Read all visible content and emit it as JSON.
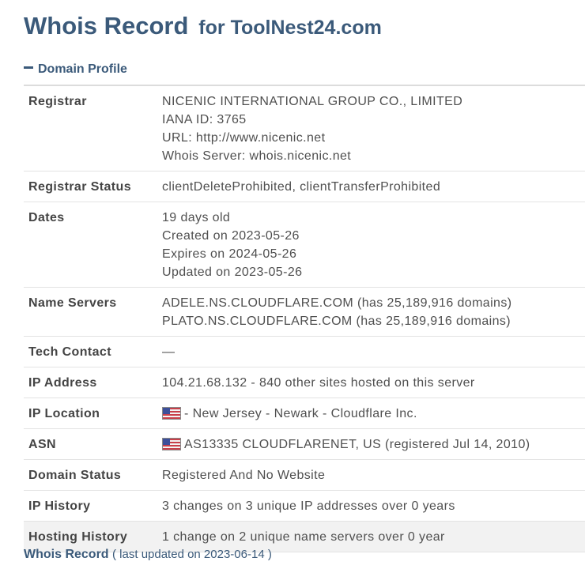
{
  "header": {
    "title": "Whois Record",
    "for_text": "for ToolNest24.com"
  },
  "section": {
    "label": "Domain Profile"
  },
  "rows": {
    "registrar": {
      "label": "Registrar",
      "lines": [
        "NICENIC INTERNATIONAL GROUP CO., LIMITED",
        "IANA ID: 3765",
        "URL: http://www.nicenic.net",
        "Whois Server: whois.nicenic.net"
      ]
    },
    "registrar_status": {
      "label": "Registrar Status",
      "value": "clientDeleteProhibited, clientTransferProhibited"
    },
    "dates": {
      "label": "Dates",
      "lines": [
        "19 days old",
        "Created on 2023-05-26",
        "Expires on 2024-05-26",
        "Updated on 2023-05-26"
      ]
    },
    "name_servers": {
      "label": "Name Servers",
      "lines": [
        "ADELE.NS.CLOUDFLARE.COM (has 25,189,916 domains)",
        "PLATO.NS.CLOUDFLARE.COM (has 25,189,916 domains)"
      ]
    },
    "tech_contact": {
      "label": "Tech Contact",
      "value": "—"
    },
    "ip_address": {
      "label": "IP Address",
      "value": "104.21.68.132 - 840 other sites hosted on this server"
    },
    "ip_location": {
      "label": "IP Location",
      "icon": "us-flag-icon",
      "value": "- New Jersey - Newark - Cloudflare Inc."
    },
    "asn": {
      "label": "ASN",
      "icon": "us-flag-icon",
      "value": "AS13335 CLOUDFLARENET, US (registered Jul 14, 2010)"
    },
    "domain_status": {
      "label": "Domain Status",
      "value": "Registered And No Website"
    },
    "ip_history": {
      "label": "IP History",
      "value": "3 changes on 3 unique IP addresses over 0 years"
    },
    "hosting_history": {
      "label": "Hosting History",
      "value": "1 change on 2 unique name servers over 0 year"
    }
  },
  "footer": {
    "label": "Whois Record",
    "note": "( last updated on 2023-06-14 )"
  },
  "colors": {
    "heading": "#3b5a7a",
    "text": "#4f4f4f",
    "row_border": "#e3e3e3",
    "hover_row": "#f2f2f2"
  }
}
